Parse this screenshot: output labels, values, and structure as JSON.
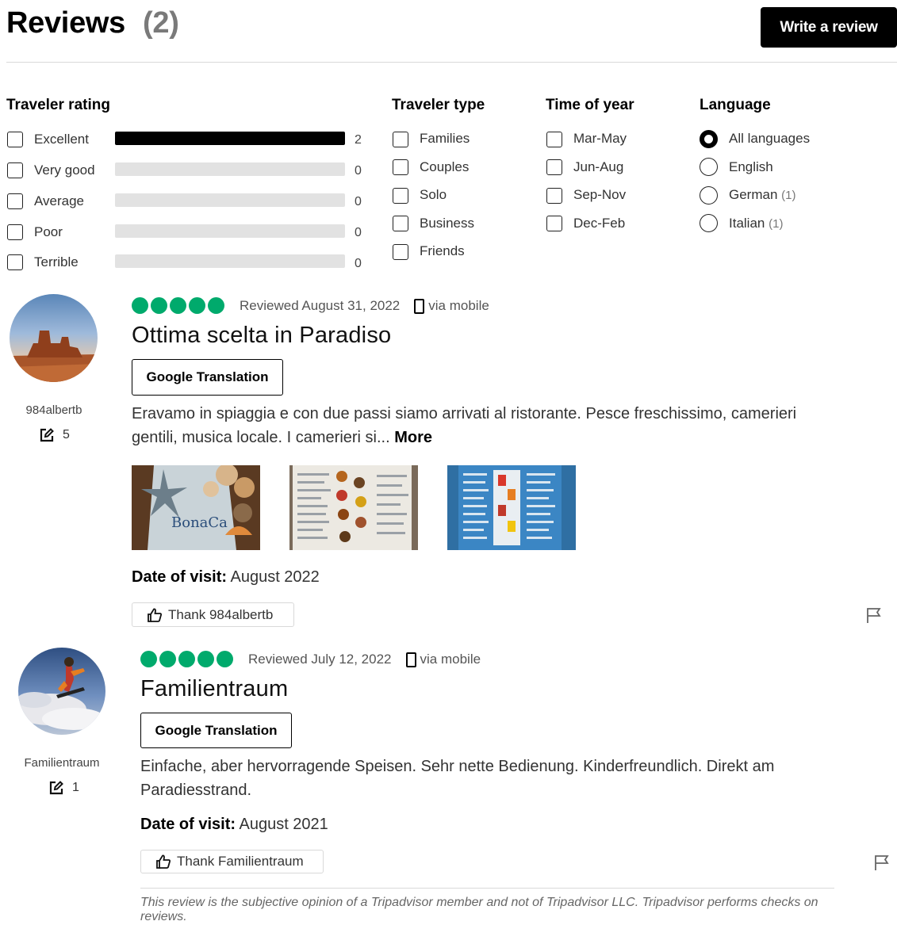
{
  "header": {
    "title": "Reviews",
    "count": "(2)",
    "write_review": "Write a review"
  },
  "filters": {
    "traveler_rating": {
      "heading": "Traveler rating",
      "items": [
        {
          "label": "Excellent",
          "count": "2",
          "fraction": 1.0
        },
        {
          "label": "Very good",
          "count": "0",
          "fraction": 0
        },
        {
          "label": "Average",
          "count": "0",
          "fraction": 0
        },
        {
          "label": "Poor",
          "count": "0",
          "fraction": 0
        },
        {
          "label": "Terrible",
          "count": "0",
          "fraction": 0
        }
      ]
    },
    "traveler_type": {
      "heading": "Traveler type",
      "items": [
        "Families",
        "Couples",
        "Solo",
        "Business",
        "Friends"
      ]
    },
    "time_of_year": {
      "heading": "Time of year",
      "items": [
        "Mar-May",
        "Jun-Aug",
        "Sep-Nov",
        "Dec-Feb"
      ]
    },
    "language": {
      "heading": "Language",
      "items": [
        {
          "label": "All languages",
          "count": "",
          "selected": true
        },
        {
          "label": "English",
          "count": "",
          "selected": false
        },
        {
          "label": "German",
          "count": "(1)",
          "selected": false
        },
        {
          "label": "Italian",
          "count": "(1)",
          "selected": false
        }
      ]
    }
  },
  "reviews": [
    {
      "username": "984albertb",
      "contributions": "5",
      "rating": 5,
      "reviewed": "Reviewed August 31, 2022",
      "via": "via mobile",
      "title": "Ottima scelta in Paradiso",
      "translate_button": "Google Translation",
      "text": "Eravamo in spiaggia e con due passi siamo arrivati al ristorante. Pesce freschissimo, camerieri gentili, musica locale. I camerieri si...",
      "more": "More",
      "photo_caption": "BonaCa",
      "date_label": "Date of visit:",
      "date_value": "August 2022",
      "thank": "Thank 984albertb"
    },
    {
      "username": "Familientraum",
      "contributions": "1",
      "rating": 5,
      "reviewed": "Reviewed July 12, 2022",
      "via": "via mobile",
      "title": "Familientraum",
      "translate_button": "Google Translation",
      "text": "Einfache, aber hervorragende Speisen. Sehr nette Bedienung. Kinderfreundlich. Direkt am Paradiesstrand.",
      "date_label": "Date of visit:",
      "date_value": "August 2021",
      "thank": "Thank Familientraum"
    }
  ],
  "disclaimer": "This review is the subjective opinion of a Tripadvisor member and not of Tripadvisor LLC. Tripadvisor performs checks on reviews.",
  "colors": {
    "bubble": "#00aa6c",
    "primary_button": "#000000",
    "bar_fill": "#000000",
    "bar_track": "#e2e2e2"
  },
  "icons": {
    "contributions": "pencil-square-icon",
    "mobile": "mobile-phone-icon",
    "thank": "thumbs-up-icon",
    "report": "flag-icon"
  }
}
